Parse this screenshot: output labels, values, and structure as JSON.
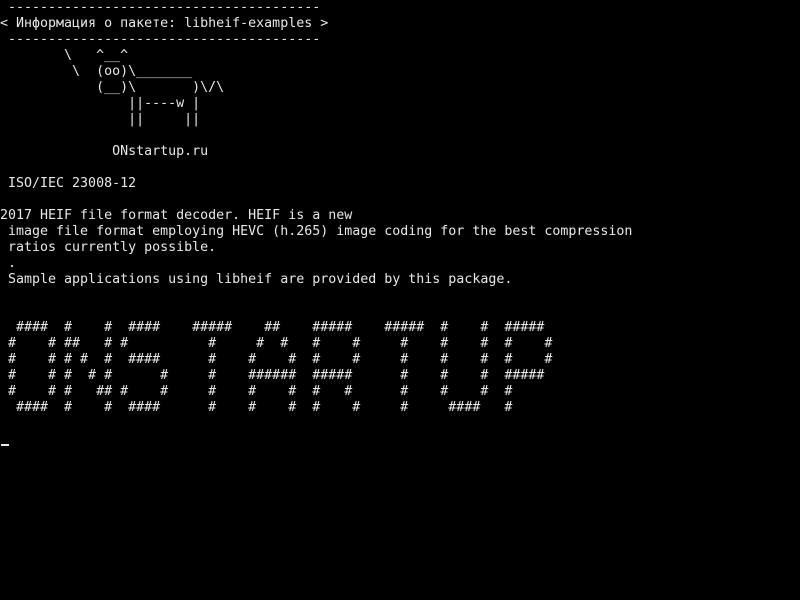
{
  "terminal": {
    "lines": [
      " ---------------------------------------",
      "< Информация о пакете: libheif-examples >",
      " ---------------------------------------",
      "        \\   ^__^",
      "         \\  (oo)\\_______",
      "            (__)\\       )\\/\\",
      "                ||----w |",
      "                ||     ||",
      "",
      "              ONstartup.ru",
      "",
      " ISO/IEC 23008-12",
      "",
      "2017 HEIF file format decoder. HEIF is a new",
      " image file format employing HEVC (h.265) image coding for the best compression",
      " ratios currently possible.",
      " .",
      " Sample applications using libheif are provided by this package.",
      "",
      "",
      "  ####  #    #  ####    #####    ##    #####    #####  #    #  #####",
      " #    # ##   # #          #     #  #   #    #     #    #    #  #    #",
      " #    # # #  #  ####      #    #    #  #    #     #    #    #  #    #",
      " #    # #  # #      #     #    ######  #####      #    #    #  #####",
      " #    # #   ## #    #     #    #    #  #   #      #    #    #  #",
      "  ####  #    #  ####      #    #    #  #    #     #     ####   #"
    ]
  }
}
